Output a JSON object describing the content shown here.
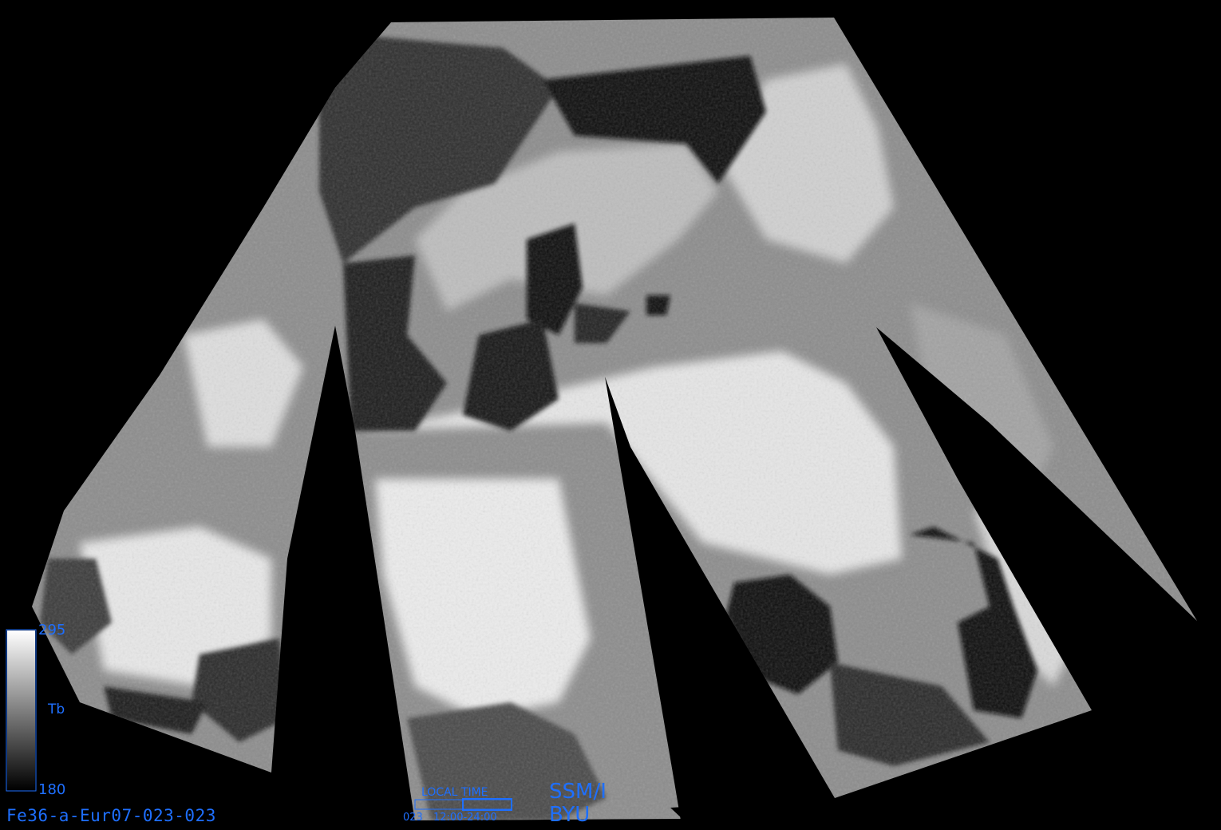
{
  "product_id": "Fe36-a-Eur07-023-023",
  "colorbar": {
    "max_label": "295",
    "min_label": "180",
    "variable_label": "Tb",
    "scale": "grayscale",
    "low_color": "#000000",
    "high_color": "#ffffff"
  },
  "local_time": {
    "label": "LOCAL TIME",
    "day": "023",
    "range": "12:00-24:00"
  },
  "credit": {
    "sensor": "SSM/I",
    "institution": "BYU"
  },
  "colors": {
    "annotation": "#1e6fff",
    "background": "#000000"
  }
}
